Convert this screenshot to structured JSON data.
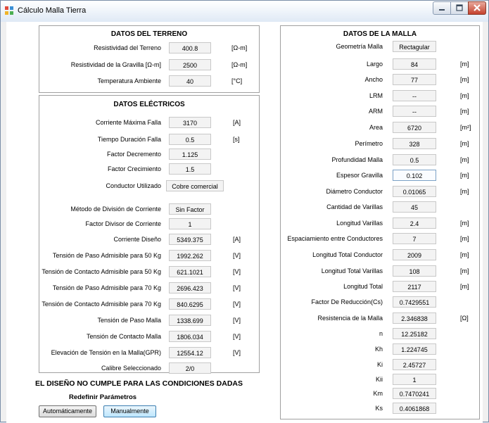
{
  "window": {
    "title": "Cálculo Malla Tierra"
  },
  "terreno": {
    "title": "DATOS DEL TERRENO",
    "rows": [
      {
        "label": "Resistividad del Terreno",
        "value": "400.8",
        "unit": "[Ω-m]"
      },
      {
        "label": "Resistividad de la Gravilla [Ω-m]",
        "value": "2500",
        "unit": "[Ω-m]"
      },
      {
        "label": "Temperatura Ambiente",
        "value": "40",
        "unit": "[°C]"
      }
    ]
  },
  "electricos": {
    "title": "DATOS ELÉCTRICOS",
    "rows": [
      {
        "label": "Corriente Máxima Falla",
        "value": "3170",
        "unit": "[A]"
      },
      {
        "label": "Tiempo Duración Falla",
        "value": "0.5",
        "unit": "[s]"
      },
      {
        "label": "Factor Decremento",
        "value": "1.125",
        "unit": ""
      },
      {
        "label": "Factor Crecimiento",
        "value": "1.5",
        "unit": ""
      },
      {
        "label": "Conductor Utilizado",
        "value": "Cobre comercial",
        "unit": ""
      },
      {
        "label": "Método de División de Corriente",
        "value": "Sin Factor",
        "unit": ""
      },
      {
        "label": "Factor Divisor de Corriente",
        "value": "1",
        "unit": ""
      },
      {
        "label": "Corriente Diseño",
        "value": "5349.375",
        "unit": "[A]"
      },
      {
        "label": "Tensión de Paso Admisible para 50 Kg",
        "value": "1992.262",
        "unit": "[V]"
      },
      {
        "label": "Tensión de Contacto Admisible para 50 Kg",
        "value": "621.1021",
        "unit": "[V]"
      },
      {
        "label": "Tensión de Paso Admisible para 70 Kg",
        "value": "2696.423",
        "unit": "[V]"
      },
      {
        "label": "Tensión de Contacto Admisible para 70 Kg",
        "value": "840.6295",
        "unit": "[V]"
      },
      {
        "label": "Tensión de Paso Malla",
        "value": "1338.699",
        "unit": "[V]"
      },
      {
        "label": "Tensión de Contacto Malla",
        "value": "1806.034",
        "unit": "[V]"
      },
      {
        "label": "Elevación de Tensión en la Malla(GPR)",
        "value": "12554.12",
        "unit": "[V]"
      },
      {
        "label": "Calibre Seleccionado",
        "value": "2/0",
        "unit": ""
      }
    ]
  },
  "malla": {
    "title": "DATOS DE LA MALLA",
    "rows": [
      {
        "label": "Geometría Malla",
        "value": "Rectagular",
        "unit": ""
      },
      {
        "label": "Largo",
        "value": "84",
        "unit": "[m]"
      },
      {
        "label": "Ancho",
        "value": "77",
        "unit": "[m]"
      },
      {
        "label": "LRM",
        "value": "--",
        "unit": "[m]"
      },
      {
        "label": "ARM",
        "value": "--",
        "unit": "[m]"
      },
      {
        "label": "Area",
        "value": "6720",
        "unit": "[m²]"
      },
      {
        "label": "Perímetro",
        "value": "328",
        "unit": "[m]"
      },
      {
        "label": "Profundidad Malla",
        "value": "0.5",
        "unit": "[m]"
      },
      {
        "label": "Espesor Gravilla",
        "value": "0.102",
        "unit": "[m]"
      },
      {
        "label": "Diámetro Conductor",
        "value": "0.01065",
        "unit": "[m]"
      },
      {
        "label": "Cantidad de Varillas",
        "value": "45",
        "unit": ""
      },
      {
        "label": "Longitud Varillas",
        "value": "2.4",
        "unit": "[m]"
      },
      {
        "label": "Espaciamiento entre Conductores",
        "value": "7",
        "unit": "[m]"
      },
      {
        "label": "Longitud Total Conductor",
        "value": "2009",
        "unit": "[m]"
      },
      {
        "label": "Longitud Total Varillas",
        "value": "108",
        "unit": "[m]"
      },
      {
        "label": "Longitud Total",
        "value": "2117",
        "unit": "[m]"
      },
      {
        "label": "Factor De Reducción(Cs)",
        "value": "0.7429551",
        "unit": ""
      },
      {
        "label": "Resistencia de la Malla",
        "value": "2.346838",
        "unit": "[Ω]"
      },
      {
        "label": "n",
        "value": "12.25182",
        "unit": ""
      },
      {
        "label": "Kh",
        "value": "1.224745",
        "unit": ""
      },
      {
        "label": "Ki",
        "value": "2.45727",
        "unit": ""
      },
      {
        "label": "Kii",
        "value": "1",
        "unit": ""
      },
      {
        "label": "Km",
        "value": "0.7470241",
        "unit": ""
      },
      {
        "label": "Ks",
        "value": "0.4061868",
        "unit": ""
      }
    ]
  },
  "result": {
    "message": "EL DISEÑO NO CUMPLE PARA LAS CONDICIONES DADAS",
    "redefine": "Redefinir Parámetros",
    "auto_button": "Automáticamente",
    "manual_button": "Manualmente"
  }
}
